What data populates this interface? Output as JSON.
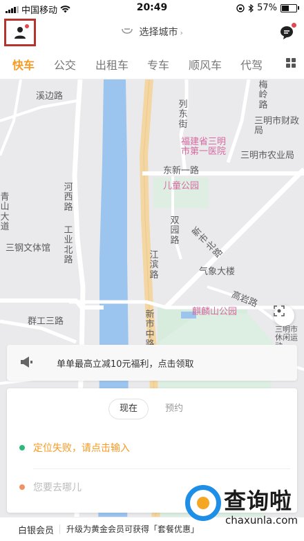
{
  "status_bar": {
    "carrier": "中国移动",
    "time": "20:49",
    "battery": "57%",
    "battery_level": 0.57
  },
  "header": {
    "city_label": "选择城市",
    "chevron": "›"
  },
  "tabs": [
    {
      "label": "快车",
      "active": true
    },
    {
      "label": "公交",
      "active": false
    },
    {
      "label": "出租车",
      "active": false
    },
    {
      "label": "专车",
      "active": false
    },
    {
      "label": "顺风车",
      "active": false
    },
    {
      "label": "代驾",
      "active": false
    }
  ],
  "map": {
    "labels": {
      "xibian": "溪边路",
      "meiling": "梅岭路",
      "liedong": "列东街",
      "caizheng": "三明市财政局",
      "hospital": "福建省三明市第一医院",
      "nongye": "三明市农业局",
      "dongxin": "东新一路",
      "ertong": "儿童公园",
      "hexi": "河西路",
      "shuangyuan": "双园路",
      "shibei": "新市北路",
      "qing": "青山大道",
      "gongyebei": "工业北路",
      "sangang": "三钢文体馆",
      "jiangbin": "江滨路",
      "qixiang": "气象大楼",
      "gaoyan": "高岩路",
      "qilin": "麒麟山公园",
      "qungong": "群工三路",
      "shizhong": "新市中路",
      "xiuxian": "三明市休闲运动"
    }
  },
  "promo": {
    "text": "单单最高立减10元福利，点击领取"
  },
  "ride_panel": {
    "options": [
      {
        "label": "现在",
        "active": true
      },
      {
        "label": "预约",
        "active": false
      }
    ],
    "pickup": "定位失败，请点击输入",
    "destination_placeholder": "您要去哪儿"
  },
  "footer": {
    "tier": "白银会员",
    "upgrade_text": "升级为黄金会员可获得「套餐优惠」"
  },
  "watermark": {
    "title": "查询啦",
    "url": "chaxunla.com"
  },
  "colors": {
    "accent": "#f59a23",
    "green_dot": "#2db880",
    "orange_dot": "#f0916a",
    "river": "#9bc4ee",
    "highlight_box": "#b7332e",
    "watermark_blue": "#1f8ee6"
  }
}
